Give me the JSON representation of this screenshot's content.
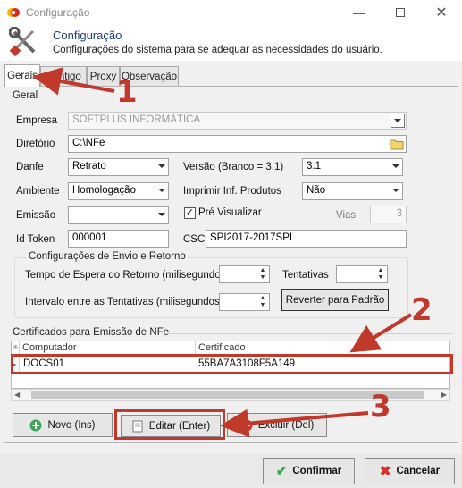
{
  "window": {
    "title": "Configuração",
    "icon": "app-logo-icon",
    "controls": [
      "minimize-icon",
      "maximize-icon",
      "close-icon"
    ]
  },
  "header": {
    "title": "Configuração",
    "subtitle": "Configurações do sistema para se adequar as necessidades do usuário.",
    "icon": "tools-icon"
  },
  "tabs": [
    {
      "label": "Gerais",
      "active": true
    },
    {
      "label": "Contigo",
      "active": false
    },
    {
      "label": "Proxy",
      "active": false
    },
    {
      "label": "Observação",
      "active": false
    }
  ],
  "geral": {
    "group_title": "Geral",
    "empresa_label": "Empresa",
    "empresa_value": "SOFTPLUS INFORMÁTICA",
    "diretorio_label": "Diretório",
    "diretorio_value": "C:\\NFe",
    "danfe_label": "Danfe",
    "danfe_value": "Retrato",
    "versao_label": "Versão (Branco = 3.1)",
    "versao_value": "3.1",
    "ambiente_label": "Ambiente",
    "ambiente_value": "Homologação",
    "imprimir_label": "Imprimir Inf. Produtos",
    "imprimir_value": "Não",
    "emissao_label": "Emissão",
    "emissao_value": "",
    "pre_visualizar_label": "Pré Visualizar",
    "pre_visualizar_checked": true,
    "vias_label": "Vias",
    "vias_value": "3",
    "idtoken_label": "Id Token",
    "idtoken_value": "000001",
    "csc_label": "CSC",
    "csc_value": "SPI2017-2017SPI"
  },
  "envio": {
    "group_title": "Configurações de Envio e Retorno",
    "tempo_label": "Tempo de Espera do Retorno (milisegundos)",
    "tempo_value": "",
    "tentativas_label": "Tentativas",
    "tentativas_value": "",
    "intervalo_label": "Intervalo entre as Tentativas (milisegundos)",
    "intervalo_value": "",
    "reverter_label": "Reverter para Padrão"
  },
  "certificados": {
    "group_title": "Certificados para Emissão de NFe",
    "columns": [
      "Computador",
      "Certificado"
    ],
    "rows": [
      {
        "computador": "DOCS01",
        "certificado": "55BA7A3108F5A149"
      }
    ]
  },
  "actions": {
    "novo_label": "Novo (Ins)",
    "editar_label": "Editar (Enter)",
    "excluir_label": "Excluir (Del)"
  },
  "footer": {
    "confirmar_label": "Confirmar",
    "cancelar_label": "Cancelar"
  },
  "annotations": {
    "color": "#c0392b",
    "labels": [
      "1",
      "2",
      "3"
    ]
  }
}
